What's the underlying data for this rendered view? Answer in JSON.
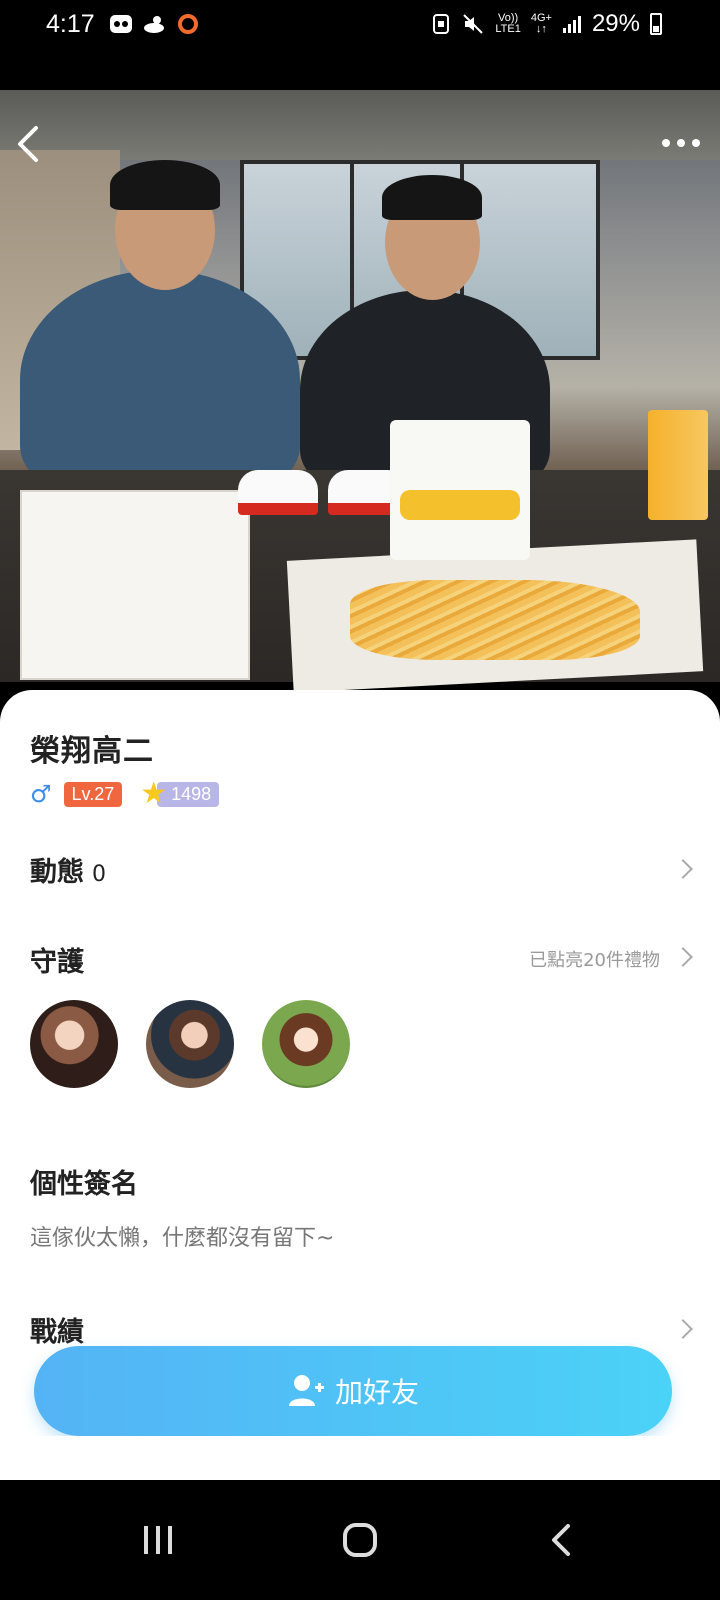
{
  "status_bar": {
    "time": "4:17",
    "battery": "29%",
    "network_top": "Vo))",
    "network_bottom": "LTE1",
    "signal_type": "4G+"
  },
  "header": {
    "back_icon": "chevron-left-icon",
    "more_icon": "more-horizontal-icon"
  },
  "profile": {
    "name": "榮翔高二",
    "gender_symbol": "♂",
    "level": "Lv.27",
    "coins": "1498"
  },
  "sections": {
    "moments": {
      "title": "動態",
      "count": "0"
    },
    "guard": {
      "title": "守護",
      "hint": "已點亮20件禮物"
    },
    "signature": {
      "title": "個性簽名",
      "text": "這傢伙太懶，什麼都沒有留下~"
    },
    "record": {
      "title": "戰績"
    }
  },
  "actions": {
    "add_friend": "加好友"
  },
  "colors": {
    "accent_blue": "#4bc3f6",
    "level_orange": "#f0663e",
    "coin_purple": "#b8b6e6",
    "gender_blue": "#3d8de8"
  }
}
